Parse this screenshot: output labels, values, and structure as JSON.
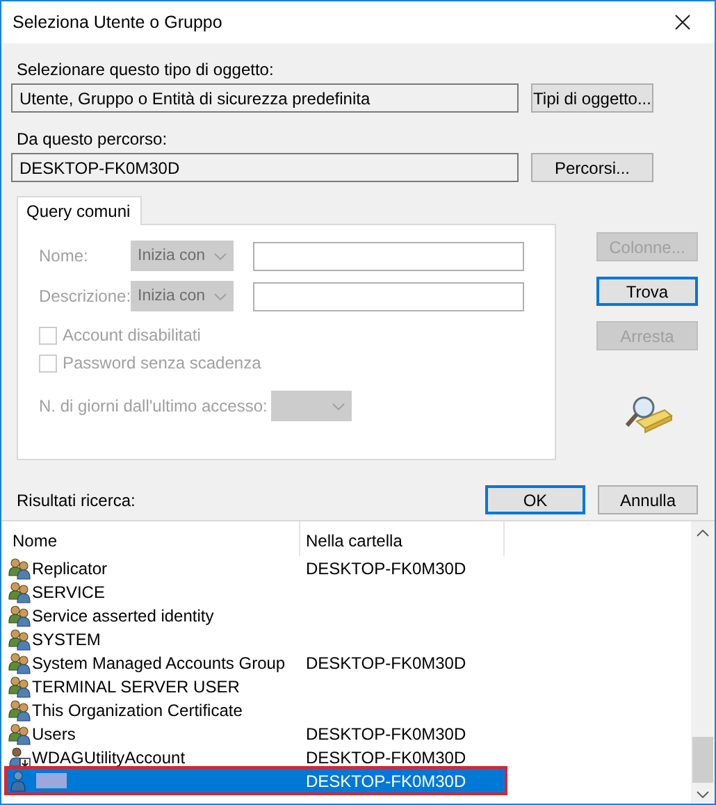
{
  "window": {
    "title": "Seleziona Utente o Gruppo"
  },
  "object_type": {
    "label": "Selezionare questo tipo di oggetto:",
    "value": "Utente, Gruppo o Entità di sicurezza predefinita",
    "button": "Tipi di oggetto..."
  },
  "location": {
    "label": "Da questo percorso:",
    "value": "DESKTOP-FK0M30D",
    "button": "Percorsi..."
  },
  "tabs": [
    {
      "label": "Query comuni",
      "selected": true
    }
  ],
  "query": {
    "fields": [
      {
        "label": "Nome:",
        "operator": "Inizia con",
        "disabled": true
      },
      {
        "label": "Descrizione:",
        "operator": "Inizia con",
        "disabled": true
      }
    ],
    "checkboxes": [
      {
        "label": "Account disabilitati",
        "checked": false,
        "disabled": true
      },
      {
        "label": "Password senza scadenza",
        "checked": false,
        "disabled": true
      }
    ],
    "days": {
      "label": "N. di giorni dall'ultimo accesso:",
      "disabled": true
    }
  },
  "side_buttons": [
    {
      "label": "Colonne...",
      "disabled": true,
      "default": false
    },
    {
      "label": "Trova",
      "disabled": false,
      "default": true
    },
    {
      "label": "Arresta",
      "disabled": true,
      "default": false
    }
  ],
  "dialog_buttons": [
    {
      "label": "OK",
      "default": true
    },
    {
      "label": "Annulla",
      "default": false
    }
  ],
  "results": {
    "label": "Risultati ricerca:",
    "columns": [
      "Nome",
      "Nella cartella"
    ],
    "rows": [
      {
        "kind": "group",
        "name": "Replicator",
        "folder": "DESKTOP-FK0M30D",
        "selected": false,
        "highlighted": false
      },
      {
        "kind": "group",
        "name": "SERVICE",
        "selected": false,
        "highlighted": false
      },
      {
        "kind": "group",
        "name": "Service asserted identity",
        "selected": false,
        "highlighted": false
      },
      {
        "kind": "group",
        "name": "SYSTEM",
        "selected": false,
        "highlighted": false
      },
      {
        "kind": "group",
        "name": "System Managed Accounts Group",
        "folder": "DESKTOP-FK0M30D",
        "selected": false,
        "highlighted": false
      },
      {
        "kind": "group",
        "name": "TERMINAL SERVER USER",
        "selected": false,
        "highlighted": false
      },
      {
        "kind": "group",
        "name": "This Organization Certificate",
        "selected": false,
        "highlighted": false
      },
      {
        "kind": "group",
        "name": "Users",
        "folder": "DESKTOP-FK0M30D",
        "selected": false,
        "highlighted": false
      },
      {
        "kind": "disabled-user",
        "name": "WDAGUtilityAccount",
        "folder": "DESKTOP-FK0M30D",
        "selected": false,
        "highlighted": false
      },
      {
        "kind": "user",
        "name_redacted": true,
        "folder": "DESKTOP-FK0M30D",
        "selected": true,
        "highlighted": true
      }
    ]
  }
}
